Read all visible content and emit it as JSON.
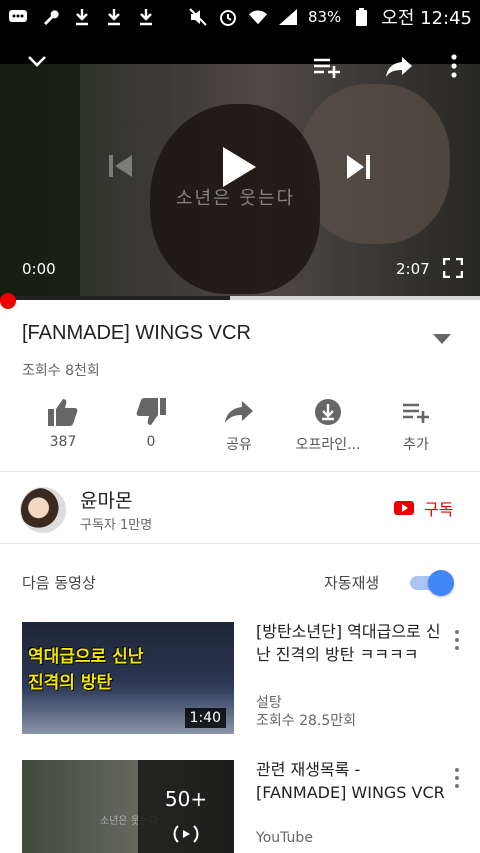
{
  "status_bar": {
    "battery": "83%",
    "time": "오전 12:45"
  },
  "player": {
    "current_time": "0:00",
    "duration": "2:07",
    "overlay_text": "소년은 웃는다",
    "progress_played": 0.0,
    "progress_buffered": 0.48
  },
  "video": {
    "title": "[FANMADE] WINGS VCR",
    "views": "조회수 8천회"
  },
  "actions": [
    {
      "label": "387",
      "icon": "thumbs-up-icon"
    },
    {
      "label": "0",
      "icon": "thumbs-down-icon"
    },
    {
      "label": "공유",
      "icon": "share-icon"
    },
    {
      "label": "오프라인...",
      "icon": "download-icon"
    },
    {
      "label": "추가",
      "icon": "add-to-playlist-icon"
    }
  ],
  "channel": {
    "name": "윤마몬",
    "subscribers": "구독자 1만명",
    "subscribe_label": "구독"
  },
  "up_next": {
    "heading": "다음 동영상",
    "autoplay_label": "자동재생",
    "autoplay_on": true
  },
  "items": [
    {
      "title": "[방탄소년단] 역대급으로 신난 진격의 방탄 ㅋㅋㅋㅋ",
      "channel": "설탕",
      "views": "조회수 28.5만회",
      "duration": "1:40",
      "thumb_caption_1": "역대급으로 신난",
      "thumb_caption_2": "진격의 방탄"
    },
    {
      "title": "관련 재생목록 - [FANMADE] WINGS VCR",
      "channel": "YouTube",
      "playlist_count": "50+",
      "thumb_text": "소년은 웃는다"
    }
  ],
  "colors": {
    "accent_red": "#e00000",
    "toggle_blue": "#4285f4"
  }
}
